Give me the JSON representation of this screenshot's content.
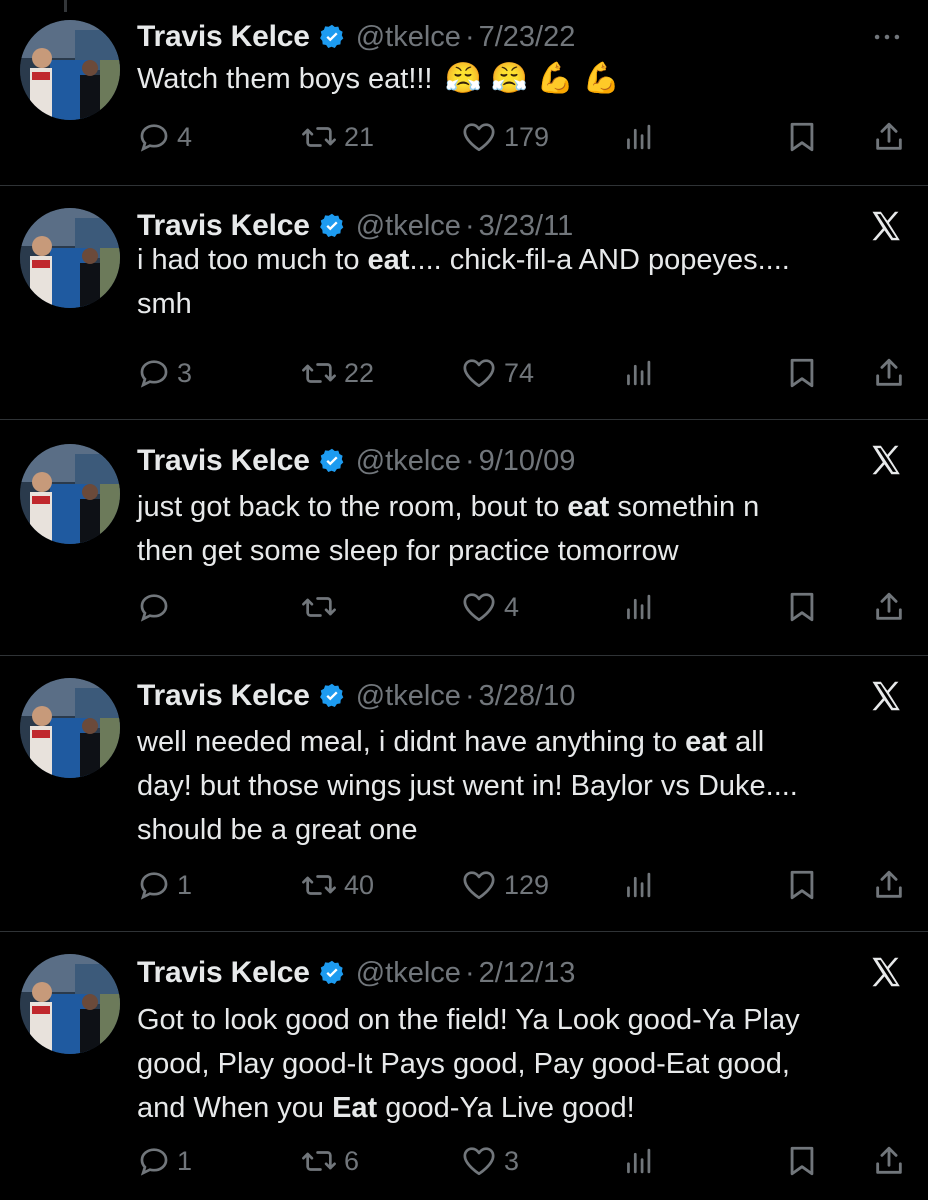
{
  "colors": {
    "background": "#000000",
    "text": "#e7e9ea",
    "secondary": "#71767b",
    "divider": "#2f3336",
    "verified": "#1d9bf0"
  },
  "author": {
    "name": "Travis Kelce",
    "handle": "@tkelce",
    "verified_icon": "verified-badge-icon"
  },
  "tweets": [
    {
      "date": "7/23/22",
      "corner_icon": "more-icon",
      "lines": [
        "Watch them boys eat!!!"
      ],
      "emojis": [
        "😤",
        "😤",
        "💪",
        "💪"
      ],
      "replies": "4",
      "reposts": "21",
      "likes": "179"
    },
    {
      "date": "3/23/11",
      "corner_icon": "x-logo-icon",
      "lines": [
        "i had too much to ",
        "eat",
        ".... chick-fil-a AND popeyes....",
        "smh"
      ],
      "replies": "3",
      "reposts": "22",
      "likes": "74"
    },
    {
      "date": "9/10/09",
      "corner_icon": "x-logo-icon",
      "lines": [
        "just got back to the room, bout to ",
        "eat",
        " somethin n",
        "then get some sleep for practice tomorrow"
      ],
      "replies": "",
      "reposts": "",
      "likes": "4"
    },
    {
      "date": "3/28/10",
      "corner_icon": "x-logo-icon",
      "lines": [
        "well needed meal, i didnt have anything to ",
        "eat",
        " all",
        "day! but those wings just went in! Baylor vs Duke....",
        "should be a great one"
      ],
      "replies": "1",
      "reposts": "40",
      "likes": "129"
    },
    {
      "date": "2/12/13",
      "corner_icon": "x-logo-icon",
      "lines": [
        "Got to look good on the field! Ya Look good-Ya Play",
        "good, Play good-It Pays good, Pay good-Eat good,",
        "and When you ",
        "Eat",
        " good-Ya Live good!"
      ],
      "replies": "1",
      "reposts": "6",
      "likes": "3"
    }
  ]
}
